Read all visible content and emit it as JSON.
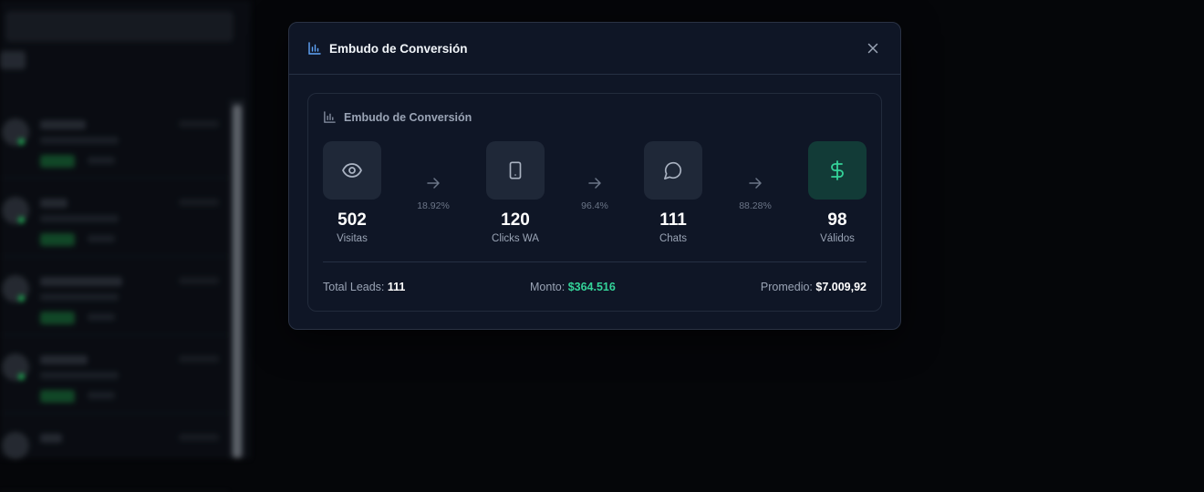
{
  "modal": {
    "title": "Embudo de Conversión",
    "card_title": "Embudo de Conversión"
  },
  "funnel": {
    "stages": [
      {
        "value": "502",
        "label": "Visitas",
        "icon": "eye-icon"
      },
      {
        "value": "120",
        "label": "Clicks WA",
        "icon": "phone-icon"
      },
      {
        "value": "111",
        "label": "Chats",
        "icon": "chat-bubble-icon"
      },
      {
        "value": "98",
        "label": "Válidos",
        "icon": "dollar-icon"
      }
    ],
    "conversions": [
      "18.92%",
      "96.4%",
      "88.28%"
    ]
  },
  "summary": {
    "total_leads_label": "Total Leads:",
    "total_leads_value": "111",
    "monto_label": "Monto:",
    "monto_value": "$364.516",
    "promedio_label": "Promedio:",
    "promedio_value": "$7.009,92"
  },
  "colors": {
    "accent_blue": "#60a5fa",
    "success_green": "#34d399",
    "modal_bg": "#0f1626"
  }
}
